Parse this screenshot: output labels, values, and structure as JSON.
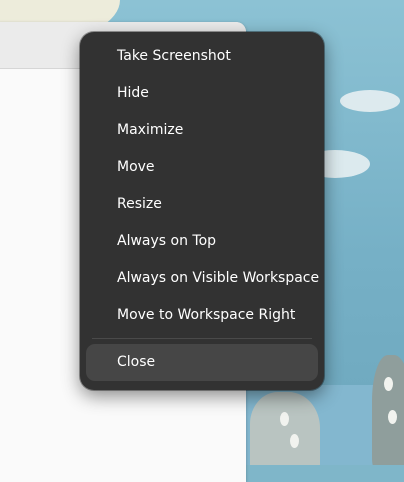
{
  "context_menu": {
    "items": [
      {
        "label": "Take Screenshot"
      },
      {
        "label": "Hide"
      },
      {
        "label": "Maximize"
      },
      {
        "label": "Move"
      },
      {
        "label": "Resize"
      },
      {
        "label": "Always on Top"
      },
      {
        "label": "Always on Visible Workspace"
      },
      {
        "label": "Move to Workspace Right"
      }
    ],
    "close_label": "Close",
    "hovered_item": "Close"
  },
  "colors": {
    "menu_background": "#323232",
    "menu_text": "#ffffff",
    "hover_background": "#464646",
    "window_background": "#fafafa",
    "wallpaper_sky": "#7fb6c9"
  }
}
